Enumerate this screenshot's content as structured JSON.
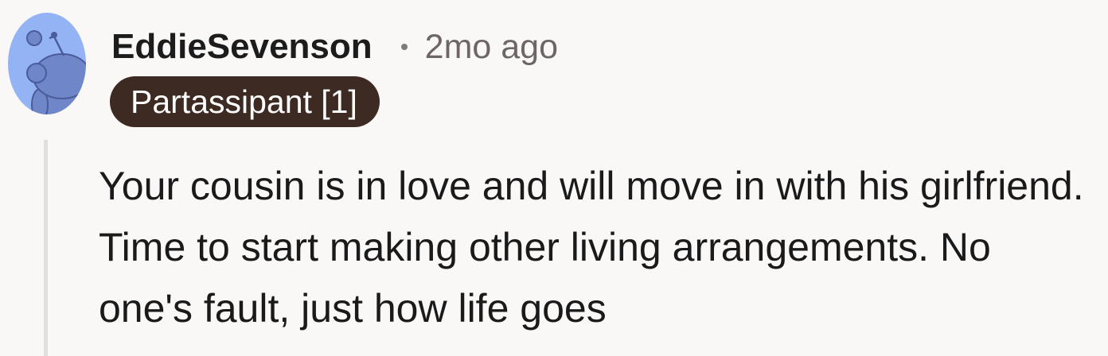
{
  "comment": {
    "author": "EddieSevenson",
    "separator": "•",
    "timestamp": "2mo ago",
    "flair": "Partassipant [1]",
    "body": "Your cousin is in love and will move in with his girlfriend. Time to start making other living arrangements. No one's fault, just how life goes"
  },
  "avatar": {
    "icon": "snoo-avatar-icon",
    "background_color": "#94b3f5",
    "figure_color": "#6f86c8"
  },
  "colors": {
    "page_background": "#faf8f6",
    "flair_background": "#3d2a22",
    "flair_text": "#ffffff",
    "timestamp_text": "#6d6664",
    "thread_line": "#e4dfdb"
  }
}
